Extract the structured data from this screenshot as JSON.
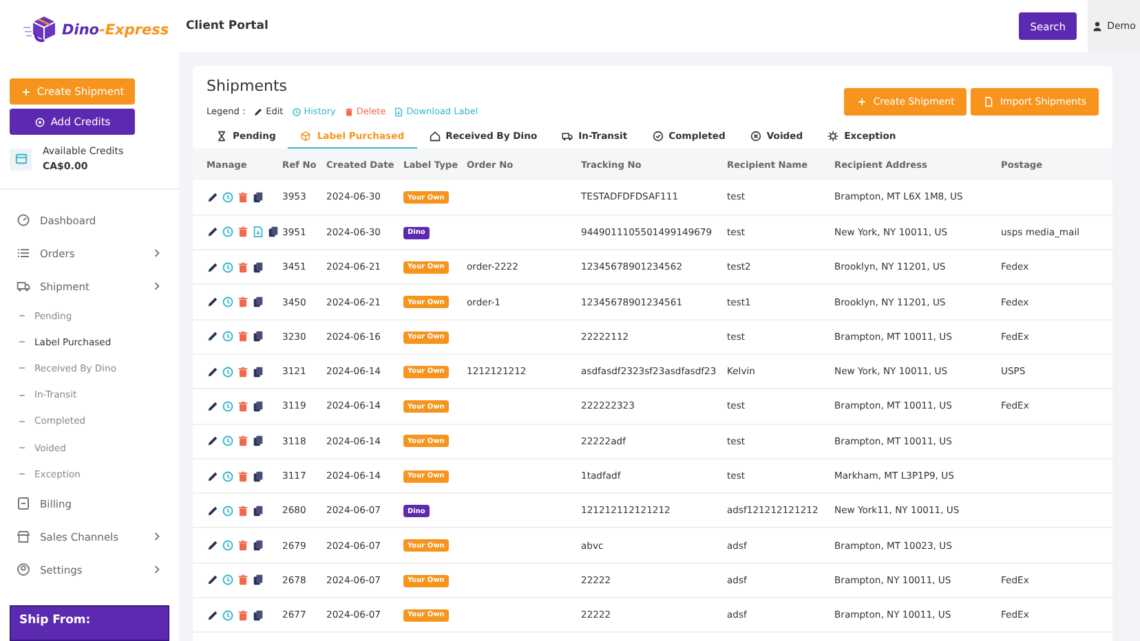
{
  "sidebar": {
    "logo": {
      "first": "Dino",
      "second": "-Express"
    },
    "create_button": "Create Shipment",
    "credits_button": "Add Credits",
    "credits": {
      "label": "Available Credits",
      "amount": "CA$0.00"
    },
    "nav": [
      {
        "label": "Dashboard",
        "kind": "dashboard",
        "expandable": false
      },
      {
        "label": "Orders",
        "kind": "orders",
        "expandable": true
      },
      {
        "label": "Shipment",
        "kind": "shipment",
        "expandable": true,
        "children": [
          {
            "label": "Pending",
            "selected": false
          },
          {
            "label": "Label Purchased",
            "selected": true
          },
          {
            "label": "Received By Dino",
            "selected": false
          },
          {
            "label": "In-Transit",
            "selected": false
          },
          {
            "label": "Completed",
            "selected": false
          },
          {
            "label": "Voided",
            "selected": false
          },
          {
            "label": "Exception",
            "selected": false
          }
        ]
      },
      {
        "label": "Billing",
        "kind": "billing",
        "expandable": false
      },
      {
        "label": "Sales Channels",
        "kind": "channels",
        "expandable": true
      },
      {
        "label": "Settings",
        "kind": "settings",
        "expandable": true
      }
    ],
    "ship_from": {
      "title": "Ship From:"
    }
  },
  "header": {
    "title": "Client Portal",
    "search_button": "Search",
    "user": "Demo"
  },
  "card": {
    "title": "Shipments",
    "legend_label": "Legend :",
    "legend": [
      {
        "kind": "edit",
        "label": "Edit"
      },
      {
        "kind": "history",
        "label": "History"
      },
      {
        "kind": "delete",
        "label": "Delete"
      },
      {
        "kind": "download",
        "label": "Download Label"
      }
    ],
    "actions": [
      {
        "kind": "create",
        "label": "Create Shipment"
      },
      {
        "kind": "import",
        "label": "Import Shipments"
      }
    ],
    "tabs": [
      {
        "kind": "pending",
        "label": "Pending",
        "selected": false
      },
      {
        "kind": "purchased",
        "label": "Label Purchased",
        "selected": true
      },
      {
        "kind": "received",
        "label": "Received By Dino",
        "selected": false
      },
      {
        "kind": "transit",
        "label": "In-Transit",
        "selected": false
      },
      {
        "kind": "completed",
        "label": "Completed",
        "selected": false
      },
      {
        "kind": "voided",
        "label": "Voided",
        "selected": false
      },
      {
        "kind": "exception",
        "label": "Exception",
        "selected": false
      }
    ],
    "table": {
      "columns": [
        "Manage",
        "Ref No",
        "Created Date",
        "Label Type",
        "Order No",
        "Tracking No",
        "Recipient Name",
        "Recipient Address",
        "Postage"
      ],
      "rows": [
        {
          "download_label": false,
          "ref": "3953",
          "date": "2024-06-30",
          "label_type": {
            "kind": "own",
            "text": "Your Own"
          },
          "order": "",
          "tracking": "TESTADFDFDSAF111",
          "name": "test",
          "address": "Brampton, MT L6X 1M8, US",
          "postage": ""
        },
        {
          "download_label": true,
          "ref": "3951",
          "date": "2024-06-30",
          "label_type": {
            "kind": "dino",
            "text": "Dino"
          },
          "order": "",
          "tracking": "9449011105501499149679",
          "name": "test",
          "address": "New York, NY 10011, US",
          "postage": "usps media_mail"
        },
        {
          "download_label": false,
          "ref": "3451",
          "date": "2024-06-21",
          "label_type": {
            "kind": "own",
            "text": "Your Own"
          },
          "order": "order-2222",
          "tracking": "12345678901234562",
          "name": "test2",
          "address": "Brooklyn, NY 11201, US",
          "postage": "Fedex"
        },
        {
          "download_label": false,
          "ref": "3450",
          "date": "2024-06-21",
          "label_type": {
            "kind": "own",
            "text": "Your Own"
          },
          "order": "order-1",
          "tracking": "12345678901234561",
          "name": "test1",
          "address": "Brooklyn, NY 11201, US",
          "postage": "Fedex"
        },
        {
          "download_label": false,
          "ref": "3230",
          "date": "2024-06-16",
          "label_type": {
            "kind": "own",
            "text": "Your Own"
          },
          "order": "",
          "tracking": "22222112",
          "name": "test",
          "address": "Brampton, MT 10011, US",
          "postage": "FedEx"
        },
        {
          "download_label": false,
          "ref": "3121",
          "date": "2024-06-14",
          "label_type": {
            "kind": "own",
            "text": "Your Own"
          },
          "order": "1212121212",
          "tracking": "asdfasdf2323sf23asdfasdf23",
          "name": "Kelvin",
          "address": "New York, NY 10011, US",
          "postage": "USPS"
        },
        {
          "download_label": false,
          "ref": "3119",
          "date": "2024-06-14",
          "label_type": {
            "kind": "own",
            "text": "Your Own"
          },
          "order": "",
          "tracking": "222222323",
          "name": "test",
          "address": "Brampton, MT 10011, US",
          "postage": "FedEx"
        },
        {
          "download_label": false,
          "ref": "3118",
          "date": "2024-06-14",
          "label_type": {
            "kind": "own",
            "text": "Your Own"
          },
          "order": "",
          "tracking": "22222adf",
          "name": "test",
          "address": "Brampton, MT 10011, US",
          "postage": ""
        },
        {
          "download_label": false,
          "ref": "3117",
          "date": "2024-06-14",
          "label_type": {
            "kind": "own",
            "text": "Your Own"
          },
          "order": "",
          "tracking": "1tadfadf",
          "name": "test",
          "address": "Markham, MT L3P1P9, US",
          "postage": ""
        },
        {
          "download_label": false,
          "ref": "2680",
          "date": "2024-06-07",
          "label_type": {
            "kind": "dino",
            "text": "Dino"
          },
          "order": "",
          "tracking": "121212112121212",
          "name": "adsf121212121212",
          "address": "New York11, NY 10011, US",
          "postage": ""
        },
        {
          "download_label": false,
          "ref": "2679",
          "date": "2024-06-07",
          "label_type": {
            "kind": "own",
            "text": "Your Own"
          },
          "order": "",
          "tracking": "abvc",
          "name": "adsf",
          "address": "Brampton, MT 10023, US",
          "postage": ""
        },
        {
          "download_label": false,
          "ref": "2678",
          "date": "2024-06-07",
          "label_type": {
            "kind": "own",
            "text": "Your Own"
          },
          "order": "",
          "tracking": "22222",
          "name": "adsf",
          "address": "Brampton, NY 10011, US",
          "postage": "FedEx"
        },
        {
          "download_label": false,
          "ref": "2677",
          "date": "2024-06-07",
          "label_type": {
            "kind": "own",
            "text": "Your Own"
          },
          "order": "",
          "tracking": "22222",
          "name": "adsf",
          "address": "Brampton, NY 10011, US",
          "postage": "FedEx"
        }
      ]
    }
  }
}
